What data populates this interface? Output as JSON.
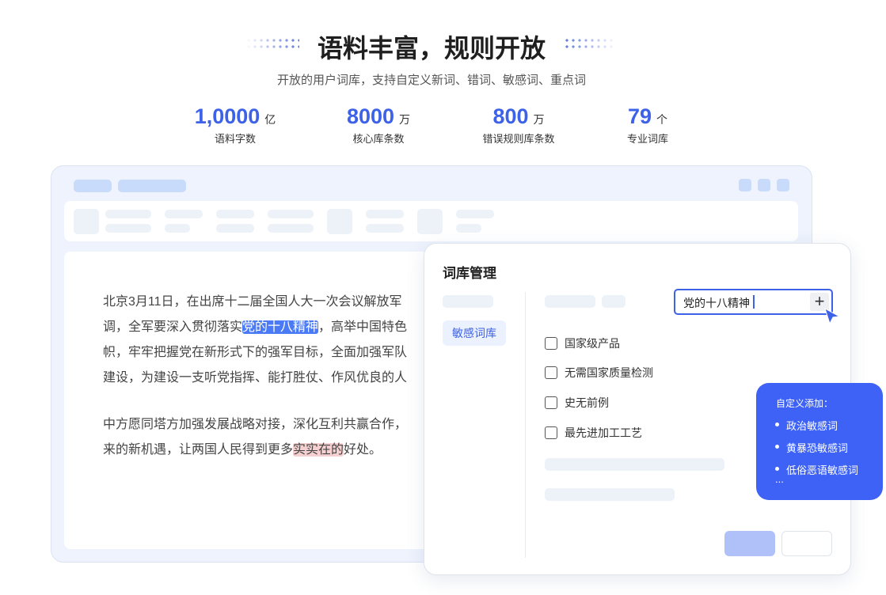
{
  "header": {
    "title": "语料丰富，规则开放",
    "subtitle": "开放的用户词库，支持自定义新词、错词、敏感词、重点词"
  },
  "stats": [
    {
      "value": "1,0000",
      "unit": "亿",
      "label": "语料字数"
    },
    {
      "value": "8000",
      "unit": "万",
      "label": "核心库条数"
    },
    {
      "value": "800",
      "unit": "万",
      "label": "错误规则库条数"
    },
    {
      "value": "79",
      "unit": "个",
      "label": "专业词库"
    }
  ],
  "document": {
    "lines": [
      {
        "text": "北京3月11日，在出席十二届全国人大一次会议解放军"
      },
      {
        "before": "调，全军要深入贯彻落实",
        "highlight": "党的十八精神",
        "after": "，高举中国特色"
      },
      {
        "text": "帜，牢牢把握党在新形式下的强军目标，全面加强军队"
      },
      {
        "text": "建设，为建设一支听党指挥、能打胜仗、作风优良的人"
      },
      {
        "text": "中方愿同塔方加强发展战略对接，深化互利共赢合作，"
      },
      {
        "before": "来的新机遇，让两国人民得到更多",
        "highlight": "实实在的",
        "after": "好处。"
      }
    ]
  },
  "dialog": {
    "title": "词库管理",
    "active_category": "敏感词库",
    "input_value": "党的十八精神",
    "add_icon": "plus-icon",
    "items": [
      "国家级产品",
      "无需国家质量检测",
      "史无前例",
      "最先进加工工艺"
    ]
  },
  "tooltip": {
    "title": "自定义添加：",
    "items": [
      "政治敏感词",
      "黄暴恐敏感词",
      "低俗恶语敏感词"
    ],
    "more": "..."
  },
  "colors": {
    "accent": "#3d62e8",
    "highlight_blue": "#4a7af5",
    "highlight_red": "#f6d0d0",
    "tooltip_bg": "#3d62f5"
  }
}
